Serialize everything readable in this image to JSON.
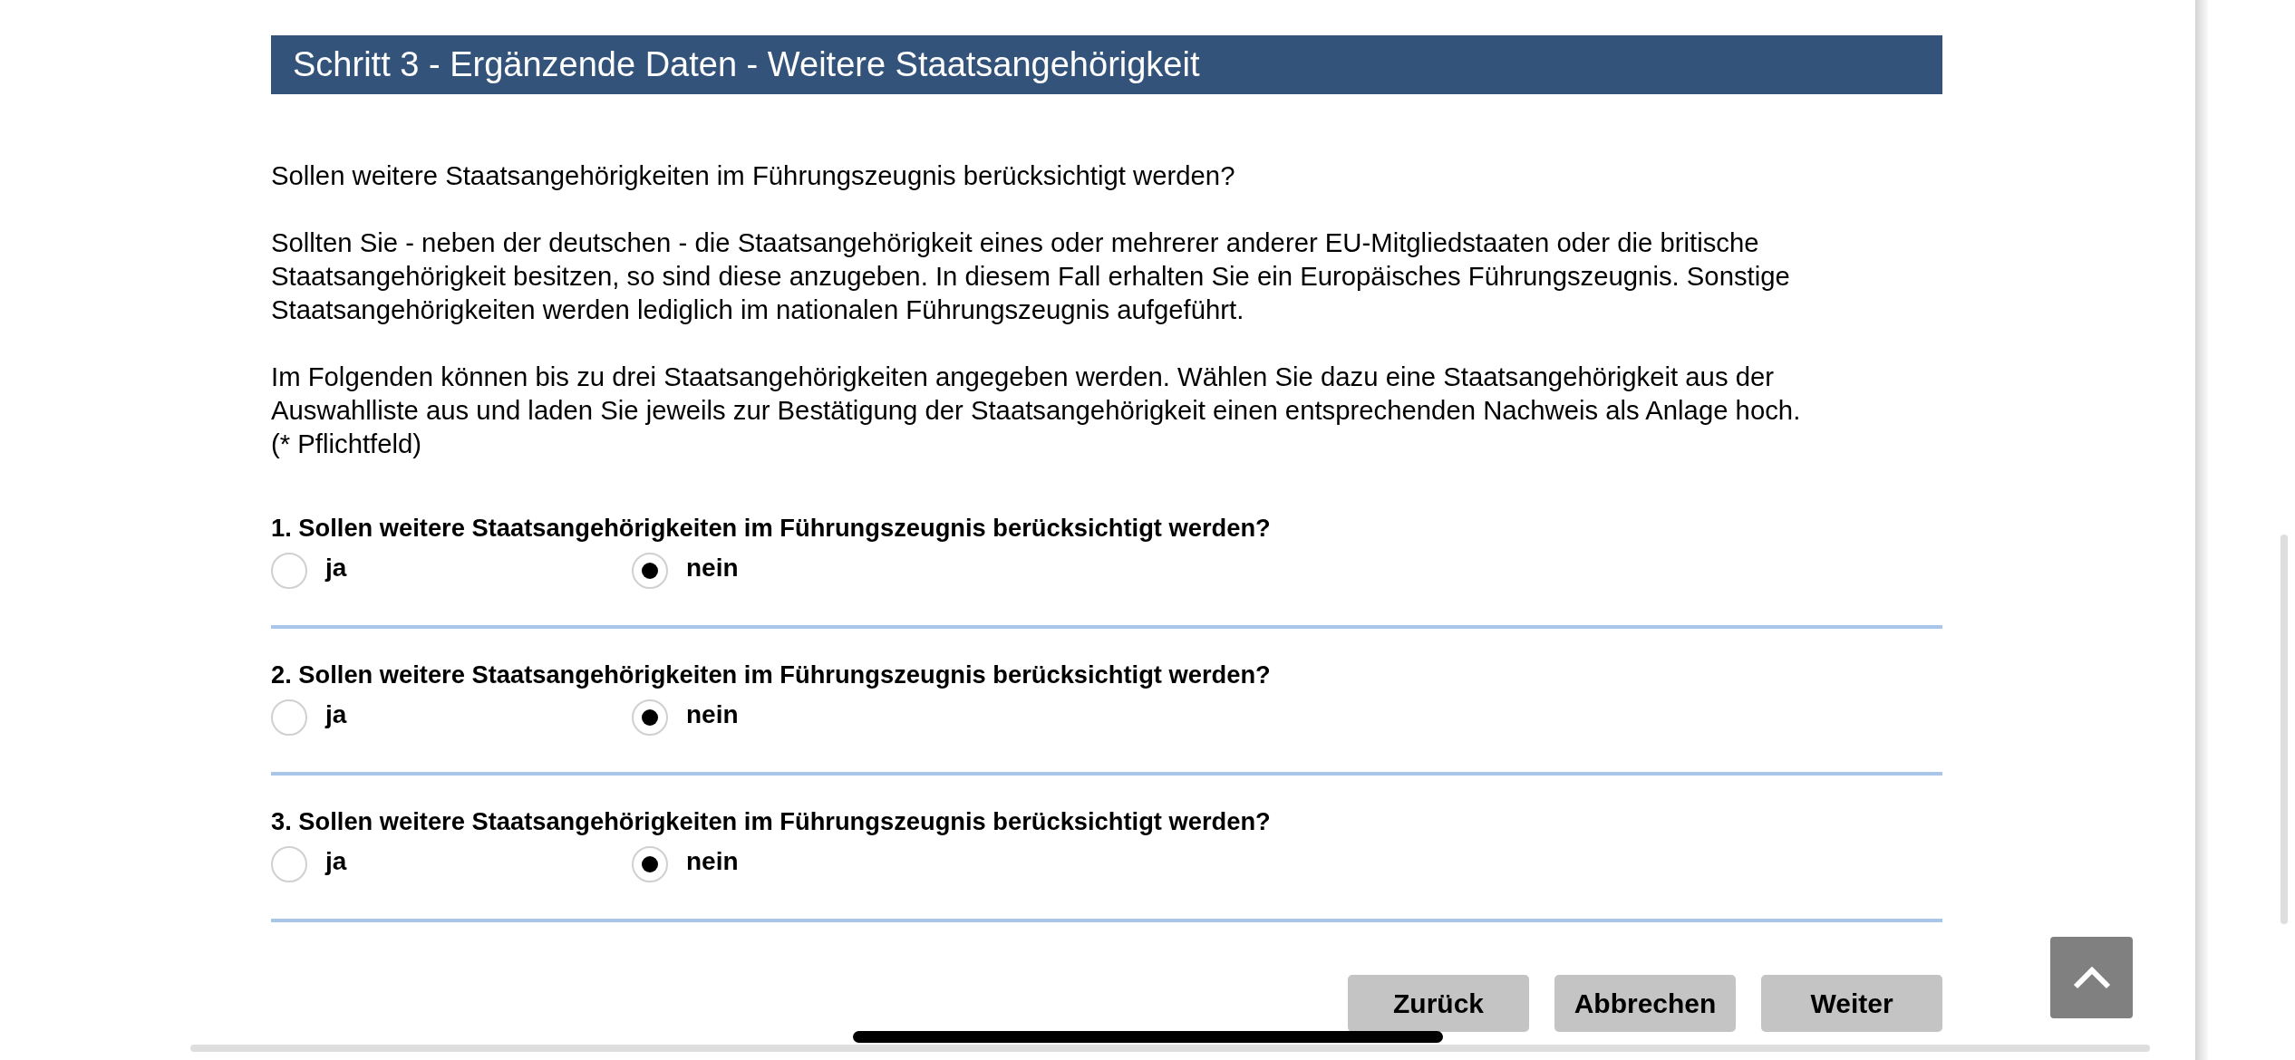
{
  "header": {
    "title": "Schritt 3 - Ergänzende Daten - Weitere Staatsangehörigkeit"
  },
  "intro": [
    "Sollen weitere Staatsangehörigkeiten im Führungszeugnis berücksichtigt werden?",
    "Sollten Sie - neben der deutschen - die Staatsangehörigkeit eines oder mehrerer anderer EU-Mitgliedstaaten oder die britische Staatsangehörigkeit besitzen, so sind diese anzugeben. In diesem Fall erhalten Sie ein Europäisches Führungszeugnis. Sonstige Staatsangehörigkeiten werden lediglich im nationalen Führungszeugnis aufgeführt.",
    "Im Folgenden können bis zu drei Staatsangehörigkeiten angegeben werden. Wählen Sie dazu eine Staatsangehörigkeit aus der Auswahlliste aus und laden Sie jeweils zur Bestätigung der Staatsangehörigkeit einen entsprechenden Nachweis als Anlage hoch."
  ],
  "required_note": "(* Pflichtfeld)",
  "questions": [
    {
      "title": "1. Sollen weitere Staatsangehörigkeiten im Führungszeugnis berücksichtigt werden?",
      "options": [
        {
          "label": "ja",
          "selected": false
        },
        {
          "label": "nein",
          "selected": true
        }
      ]
    },
    {
      "title": "2. Sollen weitere Staatsangehörigkeiten im Führungszeugnis berücksichtigt werden?",
      "options": [
        {
          "label": "ja",
          "selected": false
        },
        {
          "label": "nein",
          "selected": true
        }
      ]
    },
    {
      "title": "3. Sollen weitere Staatsangehörigkeiten im Führungszeugnis berücksichtigt werden?",
      "options": [
        {
          "label": "ja",
          "selected": false
        },
        {
          "label": "nein",
          "selected": true
        }
      ]
    }
  ],
  "buttons": [
    {
      "label": "Zurück"
    },
    {
      "label": "Abbrechen"
    },
    {
      "label": "Weiter"
    }
  ]
}
